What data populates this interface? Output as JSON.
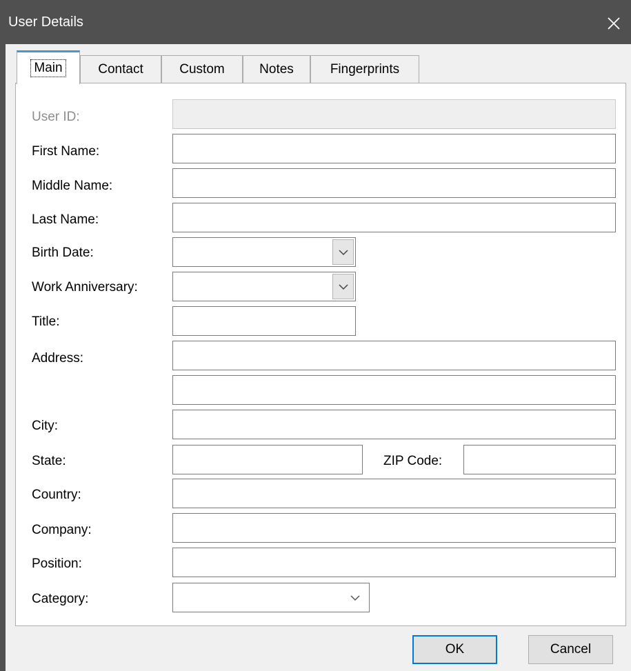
{
  "window": {
    "title": "User Details"
  },
  "tabs": [
    {
      "label": "Main",
      "active": true
    },
    {
      "label": "Contact"
    },
    {
      "label": "Custom"
    },
    {
      "label": "Notes"
    },
    {
      "label": "Fingerprints"
    }
  ],
  "form": {
    "user_id": {
      "label": "User ID:",
      "value": "",
      "disabled": true
    },
    "first_name": {
      "label": "First Name:",
      "value": ""
    },
    "middle_name": {
      "label": "Middle Name:",
      "value": ""
    },
    "last_name": {
      "label": "Last Name:",
      "value": ""
    },
    "birth_date": {
      "label": "Birth Date:",
      "value": ""
    },
    "work_anniversary": {
      "label": "Work Anniversary:",
      "value": ""
    },
    "title": {
      "label": "Title:",
      "value": ""
    },
    "address": {
      "label": "Address:",
      "line1": "",
      "line2": ""
    },
    "city": {
      "label": "City:",
      "value": ""
    },
    "state": {
      "label": "State:",
      "value": ""
    },
    "zip_code": {
      "label": "ZIP Code:",
      "value": ""
    },
    "country": {
      "label": "Country:",
      "value": ""
    },
    "company": {
      "label": "Company:",
      "value": ""
    },
    "position": {
      "label": "Position:",
      "value": ""
    },
    "category": {
      "label": "Category:",
      "value": ""
    }
  },
  "buttons": {
    "ok": "OK",
    "cancel": "Cancel"
  },
  "icons": {
    "close": "close-icon",
    "dropdown": "chevron-down-icon"
  },
  "colors": {
    "titlebar": "#505050",
    "tab_accent": "#4c93d6",
    "default_button_border": "#0078d7"
  }
}
